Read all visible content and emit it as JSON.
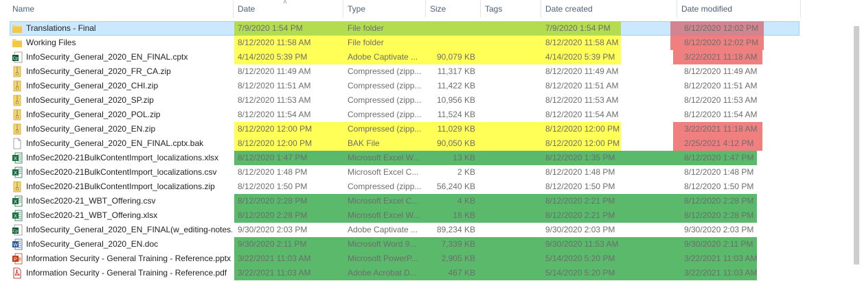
{
  "columns": {
    "name": "Name",
    "date": "Date",
    "type": "Type",
    "size": "Size",
    "tags": "Tags",
    "date_created": "Date created",
    "date_modified": "Date modified"
  },
  "colors": {
    "selection": "#cce8ff",
    "yellow": "#ffff57",
    "lime": "#b4dc50",
    "green": "#5ab96a",
    "red": "#f08080"
  },
  "files": [
    {
      "name": "Translations - Final",
      "date": "7/9/2020 1:54 PM",
      "type": "File folder",
      "size": "",
      "date_created": "7/9/2020 1:54 PM",
      "date_modified": "8/12/2020 12:02 PM",
      "icon": "folder-icon",
      "selected": true,
      "hl_main": "lime",
      "hl_mod": "red"
    },
    {
      "name": "Working Files",
      "date": "8/12/2020 11:58 AM",
      "type": "File folder",
      "size": "",
      "date_created": "8/12/2020 11:58 AM",
      "date_modified": "8/12/2020 12:02 PM",
      "icon": "folder-icon",
      "hl_main": "yellow",
      "hl_mod": "red"
    },
    {
      "name": "InfoSecurity_General_2020_EN_FINAL.cptx",
      "date": "4/14/2020 5:39 PM",
      "type": "Adobe Captivate ...",
      "size": "90,079 KB",
      "date_created": "4/14/2020 5:39 PM",
      "date_modified": "3/22/2021 11:18 AM",
      "icon": "captivate-file-icon",
      "hl_main": "yellow",
      "hl_mod": "red"
    },
    {
      "name": "InfoSecurity_General_2020_FR_CA.zip",
      "date": "8/12/2020 11:49 AM",
      "type": "Compressed (zipp...",
      "size": "11,317 KB",
      "date_created": "8/12/2020 11:49 AM",
      "date_modified": "8/12/2020 11:49 AM",
      "icon": "zip-file-icon"
    },
    {
      "name": "InfoSecurity_General_2020_CHI.zip",
      "date": "8/12/2020 11:51 AM",
      "type": "Compressed (zipp...",
      "size": "11,422 KB",
      "date_created": "8/12/2020 11:51 AM",
      "date_modified": "8/12/2020 11:51 AM",
      "icon": "zip-file-icon"
    },
    {
      "name": "InfoSecurity_General_2020_SP.zip",
      "date": "8/12/2020 11:53 AM",
      "type": "Compressed (zipp...",
      "size": "10,956 KB",
      "date_created": "8/12/2020 11:53 AM",
      "date_modified": "8/12/2020 11:53 AM",
      "icon": "zip-file-icon"
    },
    {
      "name": "InfoSecurity_General_2020_POL.zip",
      "date": "8/12/2020 11:54 AM",
      "type": "Compressed (zipp...",
      "size": "11,524 KB",
      "date_created": "8/12/2020 11:54 AM",
      "date_modified": "8/12/2020 11:54 AM",
      "icon": "zip-file-icon"
    },
    {
      "name": "InfoSecurity_General_2020_EN.zip",
      "date": "8/12/2020 12:00 PM",
      "type": "Compressed (zipp...",
      "size": "11,029 KB",
      "date_created": "8/12/2020 12:00 PM",
      "date_modified": "3/22/2021 11:18 AM",
      "icon": "zip-file-icon",
      "hl_main": "yellow",
      "hl_mod": "red"
    },
    {
      "name": "InfoSecurity_General_2020_EN_FINAL.cptx.bak",
      "date": "8/12/2020 12:00 PM",
      "type": "BAK File",
      "size": "90,050 KB",
      "date_created": "8/12/2020 12:00 PM",
      "date_modified": "2/25/2021 4:12 PM",
      "icon": "generic-file-icon",
      "hl_main": "yellow",
      "hl_mod": "red"
    },
    {
      "name": "InfoSec2020-21BulkContentImport_localizations.xlsx",
      "date": "8/12/2020 1:47 PM",
      "type": "Microsoft Excel W...",
      "size": "13 KB",
      "date_created": "8/12/2020 1:35 PM",
      "date_modified": "8/12/2020 1:47 PM",
      "icon": "excel-file-icon",
      "hl_main": "green",
      "hl_mod": "green"
    },
    {
      "name": "InfoSec2020-21BulkContentImport_localizations.csv",
      "date": "8/12/2020 1:48 PM",
      "type": "Microsoft Excel C...",
      "size": "2 KB",
      "date_created": "8/12/2020 1:48 PM",
      "date_modified": "8/12/2020 1:48 PM",
      "icon": "excel-csv-file-icon"
    },
    {
      "name": "InfoSec2020-21BulkContentImport_localizations.zip",
      "date": "8/12/2020 1:50 PM",
      "type": "Compressed (zipp...",
      "size": "56,240 KB",
      "date_created": "8/12/2020 1:50 PM",
      "date_modified": "8/12/2020 1:50 PM",
      "icon": "zip-file-icon"
    },
    {
      "name": "InfoSec2020-21_WBT_Offering.csv",
      "date": "8/12/2020 2:28 PM",
      "type": "Microsoft Excel C...",
      "size": "4 KB",
      "date_created": "8/12/2020 2:21 PM",
      "date_modified": "8/12/2020 2:28 PM",
      "icon": "excel-csv-file-icon",
      "hl_main": "green",
      "hl_mod": "green"
    },
    {
      "name": "InfoSec2020-21_WBT_Offering.xlsx",
      "date": "8/12/2020 2:28 PM",
      "type": "Microsoft Excel W...",
      "size": "18 KB",
      "date_created": "8/12/2020 2:21 PM",
      "date_modified": "8/12/2020 2:28 PM",
      "icon": "excel-file-icon",
      "hl_main": "green",
      "hl_mod": "green"
    },
    {
      "name": "InfoSecurity_General_2020_EN_FINAL(w_editing-notes....",
      "date": "9/30/2020 2:03 PM",
      "type": "Adobe Captivate ...",
      "size": "89,234 KB",
      "date_created": "9/30/2020 2:03 PM",
      "date_modified": "9/30/2020 2:03 PM",
      "icon": "captivate-file-icon"
    },
    {
      "name": "InfoSecurity_General_2020_EN.doc",
      "date": "9/30/2020 2:11 PM",
      "type": "Microsoft Word 9...",
      "size": "7,339 KB",
      "date_created": "9/30/2020 11:53 AM",
      "date_modified": "9/30/2020 2:11 PM",
      "icon": "word-file-icon",
      "hl_main": "green",
      "hl_mod": "green"
    },
    {
      "name": "Information Security - General Training - Reference.pptx",
      "date": "3/22/2021 11:03 AM",
      "type": "Microsoft PowerP...",
      "size": "2,905 KB",
      "date_created": "5/14/2020 5:20 PM",
      "date_modified": "3/22/2021 11:03 AM",
      "icon": "powerpoint-file-icon",
      "hl_main": "green",
      "hl_mod": "green"
    },
    {
      "name": "Information Security - General Training - Reference.pdf",
      "date": "3/22/2021 11:03 AM",
      "type": "Adobe Acrobat D...",
      "size": "467 KB",
      "date_created": "5/14/2020 5:20 PM",
      "date_modified": "3/22/2021 11:03 AM",
      "icon": "pdf-file-icon",
      "hl_main": "green",
      "hl_mod": "green"
    }
  ]
}
